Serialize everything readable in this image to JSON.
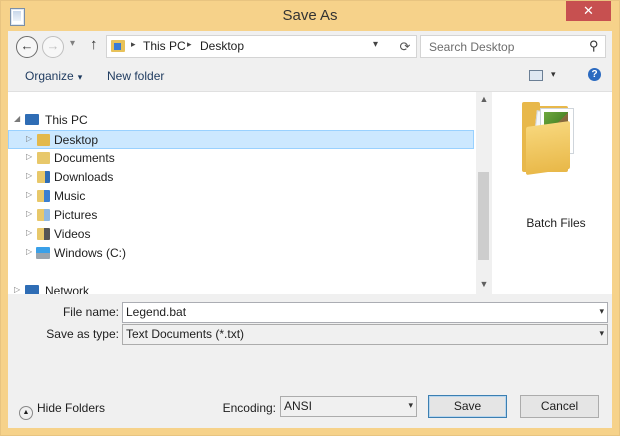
{
  "window": {
    "title": "Save As",
    "close_glyph": "✕"
  },
  "nav": {
    "back_glyph": "←",
    "forward_glyph": "→",
    "dropdown_glyph": "▾",
    "up_glyph": "↑",
    "breadcrumbs": [
      "This PC",
      "Desktop"
    ],
    "separator_glyph": "▸",
    "refresh_glyph": "⟳",
    "search_placeholder": "Search Desktop",
    "search_glyph": "⚲"
  },
  "toolbar": {
    "organize_label": "Organize",
    "organize_caret": "▾",
    "new_folder_label": "New folder",
    "view_caret": "▾",
    "help_glyph": "?"
  },
  "tree": {
    "items": [
      {
        "label": "This PC",
        "expander": "◢",
        "icon": "computer-icon"
      },
      {
        "label": "Desktop",
        "expander": "▷",
        "icon": "desktop-folder-icon",
        "selected": true
      },
      {
        "label": "Documents",
        "expander": "▷",
        "icon": "documents-folder-icon"
      },
      {
        "label": "Downloads",
        "expander": "▷",
        "icon": "downloads-folder-icon"
      },
      {
        "label": "Music",
        "expander": "▷",
        "icon": "music-folder-icon"
      },
      {
        "label": "Pictures",
        "expander": "▷",
        "icon": "pictures-folder-icon"
      },
      {
        "label": "Videos",
        "expander": "▷",
        "icon": "videos-folder-icon"
      },
      {
        "label": "Windows (C:)",
        "expander": "▷",
        "icon": "drive-icon"
      },
      {
        "label": "Network",
        "expander": "▷",
        "icon": "network-icon"
      }
    ],
    "scroll_up_glyph": "▲",
    "scroll_down_glyph": "▼"
  },
  "files": {
    "items": [
      {
        "label": "Batch Files",
        "icon": "folder-icon"
      }
    ]
  },
  "form": {
    "file_name_label": "File name:",
    "file_name_value": "Legend.bat",
    "save_type_label": "Save as type:",
    "save_type_value": "Text Documents (*.txt)",
    "dropdown_glyph": "▾"
  },
  "footer": {
    "hide_folders_glyph": "▲",
    "hide_folders_label": "Hide Folders",
    "encoding_label": "Encoding:",
    "encoding_value": "ANSI",
    "save_label": "Save",
    "cancel_label": "Cancel"
  },
  "colors": {
    "title_bar": "#f6d28a",
    "close_button": "#c75050",
    "selection": "#cce8ff",
    "link_text": "#1e3a5f"
  }
}
